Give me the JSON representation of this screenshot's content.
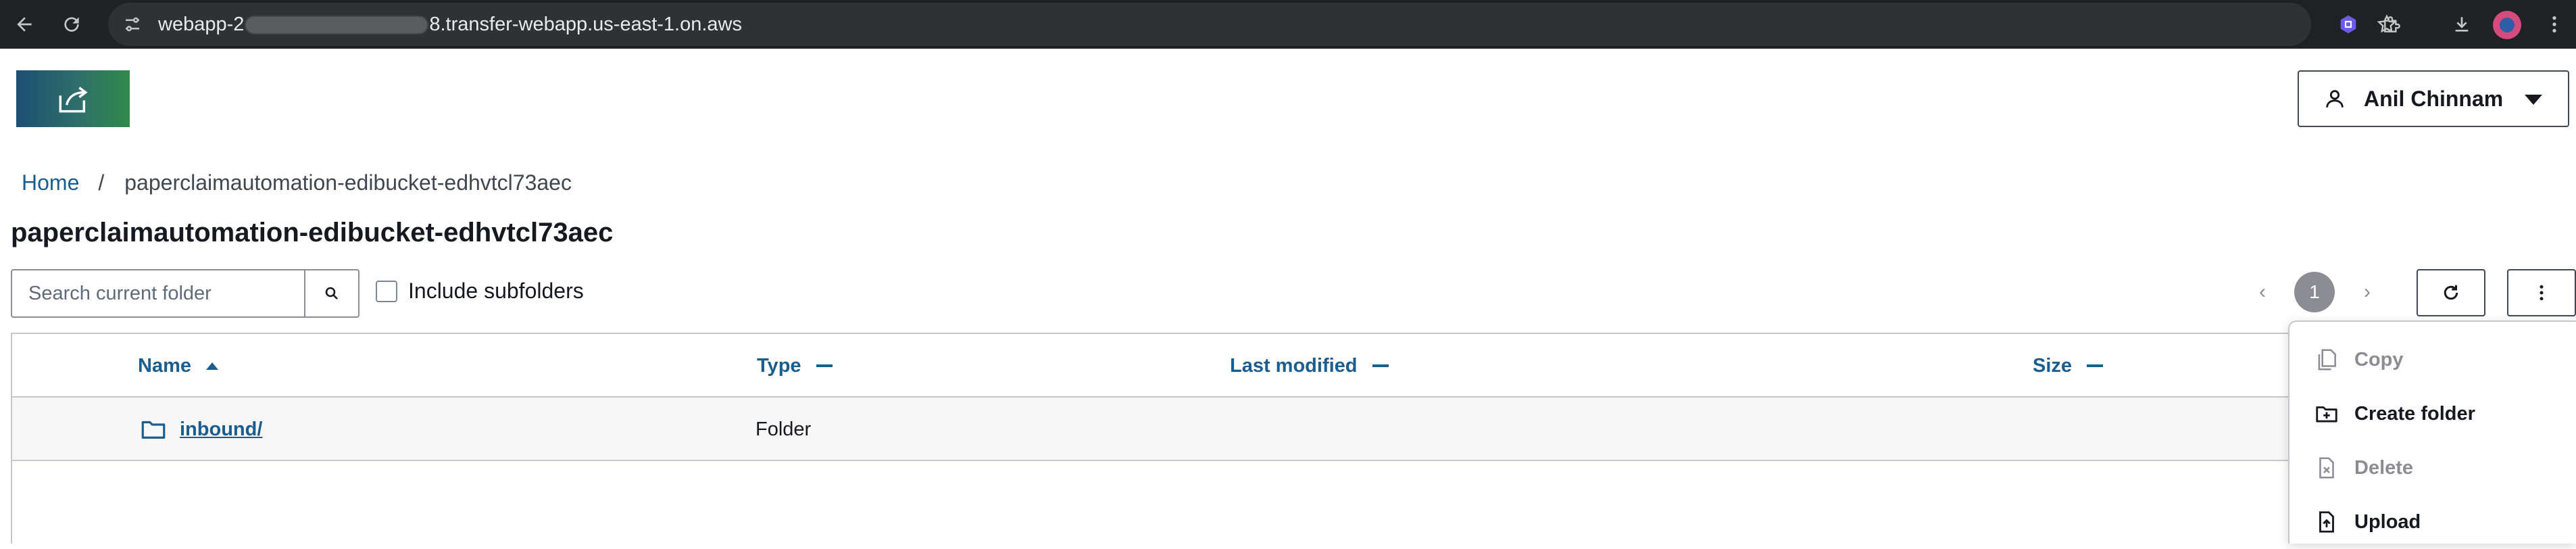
{
  "browser": {
    "url_prefix": "webapp-2",
    "url_suffix": "8.transfer-webapp.us-east-1.on.aws"
  },
  "header": {
    "user_name": "Anil Chinnam"
  },
  "breadcrumb": {
    "home": "Home",
    "separator": "/",
    "current": "paperclaimautomation-edibucket-edhvtcl73aec"
  },
  "page_title": "paperclaimautomation-edibucket-edhvtcl73aec",
  "search": {
    "placeholder": "Search current folder",
    "value": ""
  },
  "include_subfolders": {
    "label": "Include subfolders",
    "checked": false
  },
  "pagination": {
    "prev": "‹",
    "current_page": "1",
    "next": "›"
  },
  "table": {
    "columns": [
      {
        "label": "Name",
        "sort": "ascending"
      },
      {
        "label": "Type",
        "sort": "none"
      },
      {
        "label": "Last modified",
        "sort": "none"
      },
      {
        "label": "Size",
        "sort": "none"
      }
    ],
    "rows": [
      {
        "name": "inbound/",
        "type": "Folder",
        "last_modified": "",
        "size": ""
      }
    ]
  },
  "actions_menu": {
    "items": [
      {
        "label": "Copy",
        "icon": "copy-icon",
        "enabled": false
      },
      {
        "label": "Create folder",
        "icon": "folder-plus-icon",
        "enabled": true
      },
      {
        "label": "Delete",
        "icon": "file-delete-icon",
        "enabled": false
      },
      {
        "label": "Upload",
        "icon": "upload-icon",
        "enabled": true
      }
    ]
  },
  "colors": {
    "link": "#1a5d8f",
    "text": "#16191f",
    "disabled": "#8c8c94",
    "border": "#c6c6cd",
    "chrome_bar": "#202124"
  }
}
